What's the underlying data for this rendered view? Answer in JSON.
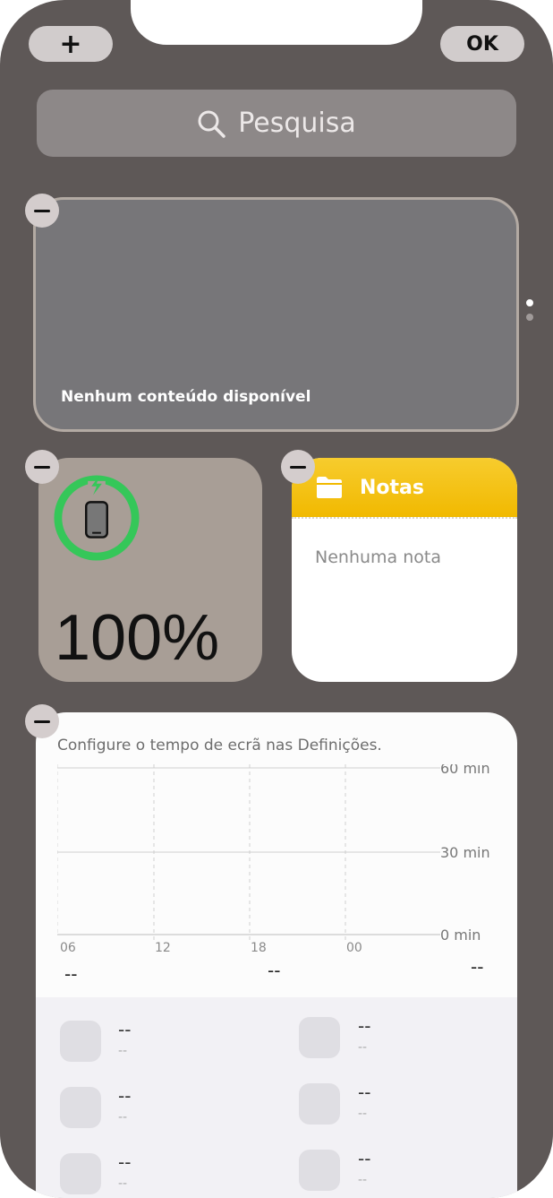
{
  "toolbar": {
    "add_label": "+",
    "done_label": "OK"
  },
  "search": {
    "placeholder": "Pesquisa"
  },
  "widgets": {
    "large": {
      "empty_text": "Nenhum conteúdo disponível"
    },
    "battery": {
      "value": "100%",
      "level": 1.0,
      "charging": true,
      "ring_color": "#35c759"
    },
    "notes": {
      "title": "Notas",
      "empty_text": "Nenhuma nota",
      "accent": "#f4c20d"
    },
    "screen_time": {
      "caption": "Configure o tempo de ecrã nas Definições.",
      "chart_data": {
        "type": "bar",
        "x_ticks": [
          "06",
          "12",
          "18",
          "00"
        ],
        "y_ticks": [
          "60 min",
          "30 min",
          "0 min"
        ],
        "values": [],
        "ylim": [
          0,
          60
        ]
      },
      "summary": [
        "--",
        "--",
        "--"
      ],
      "apps": [
        {
          "name": "--",
          "sub": "--"
        },
        {
          "name": "--",
          "sub": "--"
        },
        {
          "name": "--",
          "sub": "--"
        },
        {
          "name": "--",
          "sub": "--"
        },
        {
          "name": "--",
          "sub": "--"
        },
        {
          "name": "--",
          "sub": "--"
        }
      ]
    }
  },
  "page_dots": {
    "count": 2,
    "active": 0
  }
}
